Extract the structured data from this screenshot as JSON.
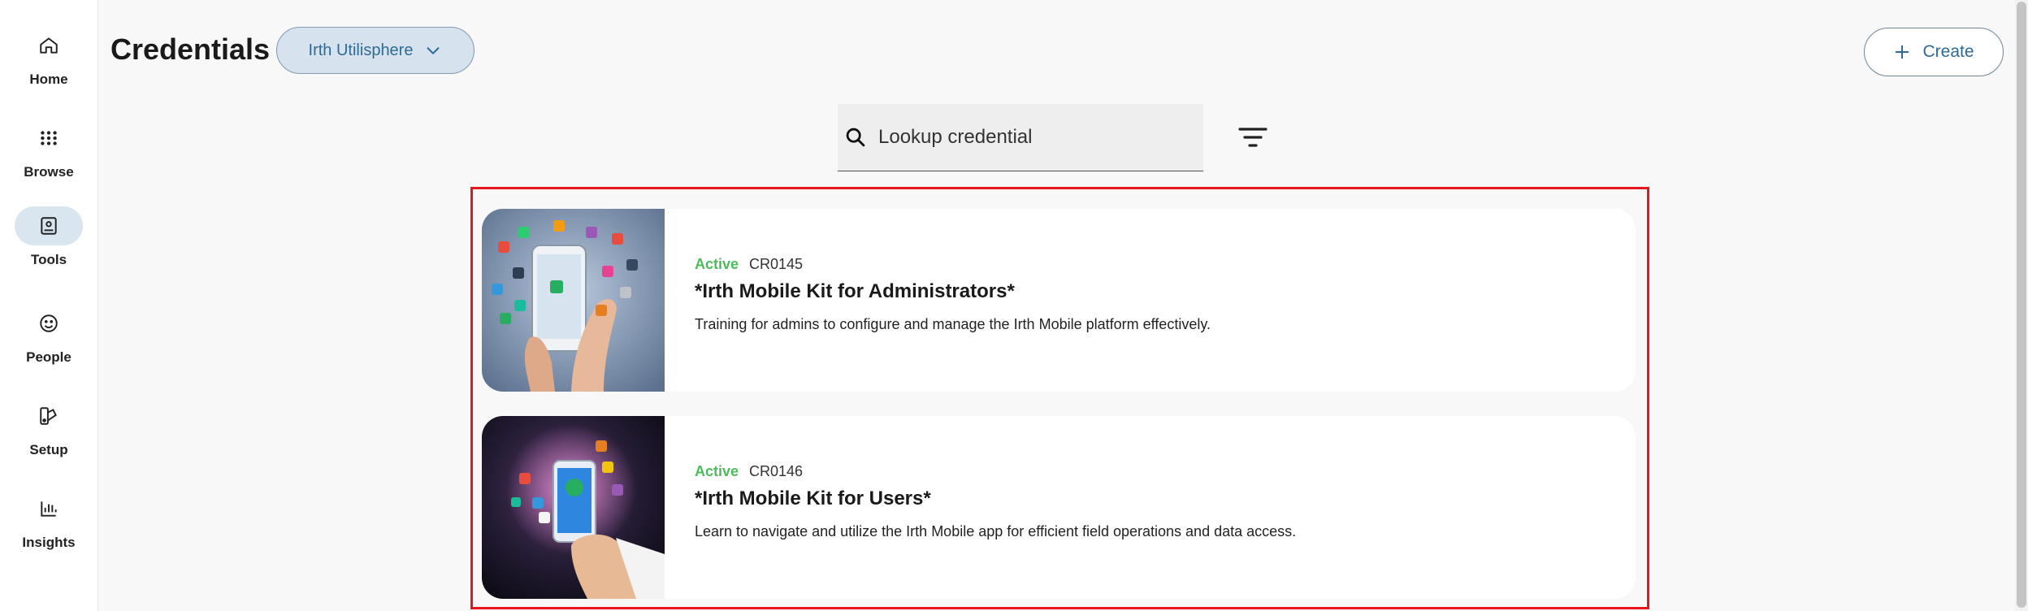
{
  "sidebar": {
    "items": [
      {
        "label": "Home",
        "icon": "home-icon"
      },
      {
        "label": "Browse",
        "icon": "grid-dots-icon"
      },
      {
        "label": "Tools",
        "icon": "tools-book-icon",
        "active": true
      },
      {
        "label": "People",
        "icon": "smile-icon"
      },
      {
        "label": "Setup",
        "icon": "setup-icon"
      },
      {
        "label": "Insights",
        "icon": "bar-chart-icon"
      }
    ]
  },
  "header": {
    "title": "Credentials",
    "org_selector": "Irth Utilisphere",
    "create_label": "Create"
  },
  "search": {
    "placeholder": "Lookup credential",
    "value": ""
  },
  "credentials": [
    {
      "status": "Active",
      "code": "CR0145",
      "title": "*Irth Mobile Kit for Administrators*",
      "description": "Training for admins to configure and manage the Irth Mobile platform effectively."
    },
    {
      "status": "Active",
      "code": "CR0146",
      "title": "*Irth Mobile Kit for Users*",
      "description": "Learn to navigate and utilize the Irth Mobile app for efficient field operations and data access."
    }
  ],
  "colors": {
    "accent": "#2f6a96",
    "active_status": "#4cbc5c",
    "highlight_frame": "#e8141e",
    "nav_active": "#d9e6f0"
  }
}
